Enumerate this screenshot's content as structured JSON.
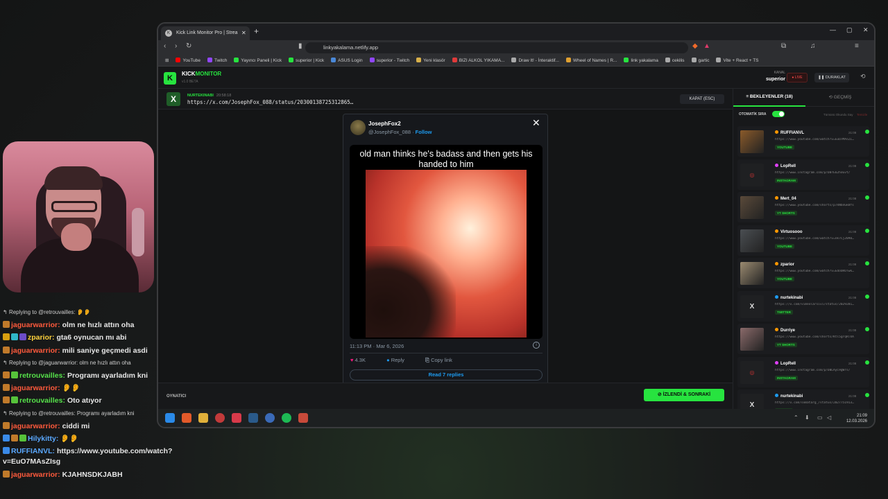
{
  "chat": [
    {
      "type": "reply",
      "text": "Replying to @retrouvailles: 👂👂"
    },
    {
      "type": "msg",
      "user": "jaguarwarrior:",
      "color": "#ff5a3c",
      "badges": [
        "#c07a2a"
      ],
      "text": "olm ne hızlı attın oha"
    },
    {
      "type": "msg",
      "user": "zparior:",
      "color": "#ffd23c",
      "badges": [
        "#d8a010",
        "#2fb7c8",
        "#6c4cc8"
      ],
      "text": "gta6 oynucan mı abi"
    },
    {
      "type": "msg",
      "user": "jaguarwarrior:",
      "color": "#ff5a3c",
      "badges": [
        "#c07a2a"
      ],
      "text": "mili saniye geçmedi asdi"
    },
    {
      "type": "reply",
      "text": "Replying to @jaguarwarrior: olm ne hızlı attın oha"
    },
    {
      "type": "msg",
      "user": "retrouvailles:",
      "color": "#56e24a",
      "badges": [
        "#c07a2a",
        "#56c23a"
      ],
      "text": "Programı ayarladım kni"
    },
    {
      "type": "msg",
      "user": "jaguarwarrior:",
      "color": "#ff5a3c",
      "badges": [
        "#c07a2a"
      ],
      "text": "👂👂"
    },
    {
      "type": "msg",
      "user": "retrouvailles:",
      "color": "#56e24a",
      "badges": [
        "#c07a2a",
        "#56c23a"
      ],
      "text": "Oto atıyor"
    },
    {
      "type": "reply",
      "text": "Replying to @retrouvailles: Programı ayarladım kni"
    },
    {
      "type": "msg",
      "user": "jaguarwarrior:",
      "color": "#ff5a3c",
      "badges": [
        "#c07a2a"
      ],
      "text": "ciddi mi"
    },
    {
      "type": "msg",
      "user": "Hilykitty:",
      "color": "#5aa8ff",
      "badges": [
        "#3a8ae8",
        "#c07a2a",
        "#56c23a"
      ],
      "text": "👂👂"
    },
    {
      "type": "msg",
      "user": "RUFFIANVL:",
      "color": "#5aa8ff",
      "badges": [
        "#3a8ae8"
      ],
      "text": "https://www.youtube.com/watch?v=EuO7MAsZIsg",
      "tall": true
    },
    {
      "type": "msg",
      "user": "jaguarwarrior:",
      "color": "#ff5a3c",
      "badges": [
        "#c07a2a"
      ],
      "text": "KJAHNSDKJABH"
    }
  ],
  "browser": {
    "tab_title": "Kick Link Monitor Pro | Strea",
    "url": "linkyakalama.netlify.app",
    "bookmarks": [
      {
        "label": "YouTube",
        "color": "#ff0000"
      },
      {
        "label": "Twitch",
        "color": "#9146ff"
      },
      {
        "label": "Yayıncı Paneli | Kick",
        "color": "#27e33f"
      },
      {
        "label": "superior | Kick",
        "color": "#27e33f"
      },
      {
        "label": "ASUS Login",
        "color": "#4a88d8"
      },
      {
        "label": "superior - Twitch",
        "color": "#9146ff"
      },
      {
        "label": "Yeni klasör",
        "color": "#d8b04a"
      },
      {
        "label": "BIZI ALKOL YIKAMA...",
        "color": "#e03a3a"
      },
      {
        "label": "Draw It! - İnteraktif...",
        "color": "#aaaaaa"
      },
      {
        "label": "Wheel of Names | R...",
        "color": "#e0a030"
      },
      {
        "label": "link yakalama",
        "color": "#27e33f"
      },
      {
        "label": "cekilis",
        "color": "#aaaaaa"
      },
      {
        "label": "gartic",
        "color": "#aaaaaa"
      },
      {
        "label": "Vite + React + TS",
        "color": "#aaaaaa"
      }
    ]
  },
  "app": {
    "brand_a": "KICK",
    "brand_b": "MONITOR",
    "version": "v1.0 BETA",
    "kanal_label": "KANAL",
    "kanal_value": "superior",
    "live_label": "LIVE",
    "pause_label": "DURAKLAT",
    "current": {
      "user": "NURTEKINABI",
      "time": "20:58:18",
      "url": "https://x.com/JosephFox_088/status/20300138725312865…",
      "close_label": "KAPAT (ESC)"
    },
    "tweet": {
      "name": "JosephFox2",
      "handle": "@JosephFox_088",
      "follow": "Follow",
      "caption": "old man thinks he's badass and then gets his handed to him",
      "time": "11:13 PM · Mar 6, 2026",
      "likes": "4.3K",
      "reply": "Reply",
      "copy": "Copy link",
      "read": "Read 7 replies"
    },
    "footer_label": "OYNATICI",
    "next_label": "İZLENDİ & SONRAKİ",
    "tabs": {
      "waiting": "BEKLEYENLER (18)",
      "history": "GEÇMİŞ"
    },
    "auto_label": "OTOMATİK SIRA",
    "auto_hint": "Tümünü Okundu Say",
    "auto_hint2": "Temizle",
    "queue": [
      {
        "user": "RUFFIANVL",
        "dot": "#ff9800",
        "url": "https://www.youtube.com/watch?v=EuO7MAsZI…",
        "badge": "YOUTUBE",
        "time": "21:08",
        "thumb": "#8a5a2a"
      },
      {
        "user": "LopRell",
        "dot": "#e040fb",
        "url": "https://www.instagram.com/p/DBrE62hoGvt/",
        "badge": "INSTAGRAM",
        "time": "21:08",
        "thumb": "ph"
      },
      {
        "user": "Mert_04",
        "dot": "#ff9800",
        "url": "https://www.youtube.com/shorts/p7XNbnGk8fs",
        "badge": "YT SHORTS",
        "time": "21:08",
        "thumb": "#5a4a3a"
      },
      {
        "user": "Virtuosooo",
        "dot": "#ff9800",
        "url": "https://www.youtube.com/watch?v=nk7Cj2090…",
        "badge": "YOUTUBE",
        "time": "21:08",
        "thumb": "#4a4e52"
      },
      {
        "user": "zparior",
        "dot": "#ff9800",
        "url": "https://www.youtube.com/watch?v=EdoOROTwk…",
        "badge": "YOUTUBE",
        "time": "21:08",
        "thumb": "#9a8a70"
      },
      {
        "user": "nurtekinabi",
        "dot": "#1d9bf0",
        "url": "https://x.com/vimeolarsivi/status/2029281…",
        "badge": "TWITTER",
        "time": "21:08",
        "thumb": "x"
      },
      {
        "user": "Durriye",
        "dot": "#ff9800",
        "url": "https://www.youtube.com/shorts/Ktl5grqRTXA",
        "badge": "YT SHORTS",
        "time": "21:08",
        "thumb": "#8a6a6a"
      },
      {
        "user": "LopRell",
        "dot": "#e040fb",
        "url": "https://www.instagram.com/p/DBLAyC9gWrs/",
        "badge": "INSTAGRAM",
        "time": "21:08",
        "thumb": "ph"
      },
      {
        "user": "nurtekinabi",
        "dot": "#1d9bf0",
        "url": "https://x.com/somatarg_/status/2027751913…",
        "badge": "TWITTER",
        "time": "21:08",
        "thumb": "x"
      }
    ]
  },
  "taskbar": {
    "time": "21:09",
    "date": "12.03.2026"
  }
}
